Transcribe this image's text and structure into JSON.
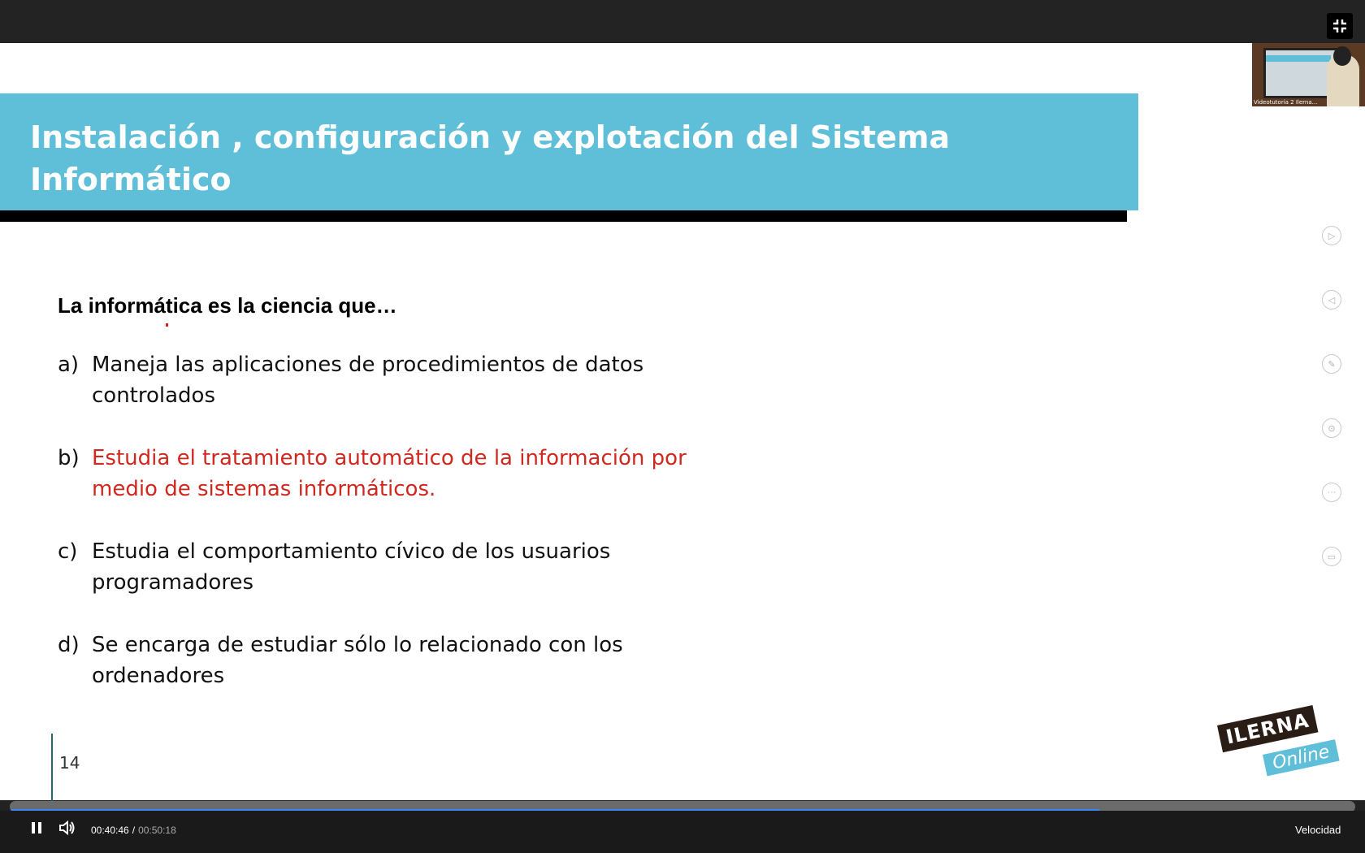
{
  "slide": {
    "title_line1": "Instalación , configuración y explotación del Sistema",
    "title_line2": "Informático",
    "question": "La informática es la ciencia que…",
    "options": [
      {
        "letter": "a)",
        "line1": "Maneja las aplicaciones de procedimientos de datos",
        "line2": "controlados"
      },
      {
        "letter": "b)",
        "line1": "Estudia el tratamiento automático de la información por",
        "line2": "medio de sistemas informáticos."
      },
      {
        "letter": "c)",
        "line1": "Estudia el comportamiento cívico de los usuarios",
        "line2": "programadores"
      },
      {
        "letter": "d)",
        "line1": "Se encarga de estudiar sólo lo relacionado con los",
        "line2": "ordenadores"
      }
    ],
    "correct_color": "#d0281e",
    "page_number": "14",
    "logo": {
      "brand": "ILERNA",
      "sub": "Online"
    }
  },
  "webcam": {
    "caption": "Videotutoría 2 Ilerna..."
  },
  "side_toolbar": [
    "play-next-icon",
    "play-prev-icon",
    "pen-icon",
    "laser-icon",
    "more-icon",
    "screen-icon"
  ],
  "player": {
    "current_time": "00:40:46",
    "separator": "/",
    "total_time": "00:50:18",
    "progress": 0.81,
    "speed_label": "Velocidad"
  },
  "colors": {
    "accent": "#5fbfd8",
    "progress": "#3b82f6"
  }
}
